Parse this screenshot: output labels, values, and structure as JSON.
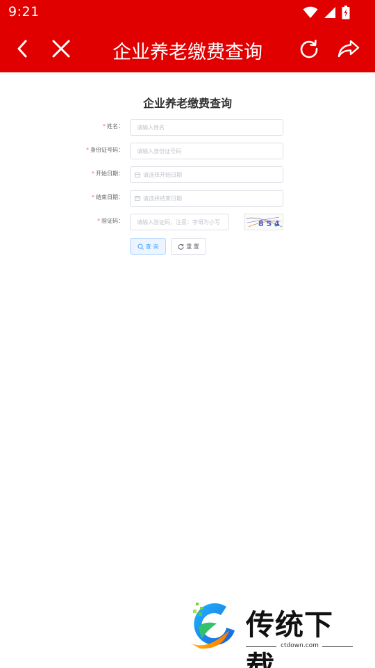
{
  "status_bar": {
    "time": "9:21"
  },
  "header": {
    "title": "企业养老缴费查询"
  },
  "form": {
    "title": "企业养老缴费查询",
    "fields": [
      {
        "label": "姓名：",
        "placeholder": "请输入姓名"
      },
      {
        "label": "身份证号码：",
        "placeholder": "请输入身份证号码"
      },
      {
        "label": "开始日期：",
        "placeholder": "请选择开始日期"
      },
      {
        "label": "结束日期：",
        "placeholder": "请选择结束日期"
      },
      {
        "label": "验证码：",
        "placeholder": "请输入验证码，注意：字母为小写"
      }
    ],
    "required_mark": "*",
    "captcha_text": "8 5 4 6",
    "query_button": "查 询",
    "reset_button": "重 置"
  },
  "watermark": {
    "brand": "传统下载",
    "url": "ctdown.com"
  },
  "colors": {
    "header_bg": "#e00000",
    "primary": "#409eff",
    "required": "#f56c6c"
  }
}
